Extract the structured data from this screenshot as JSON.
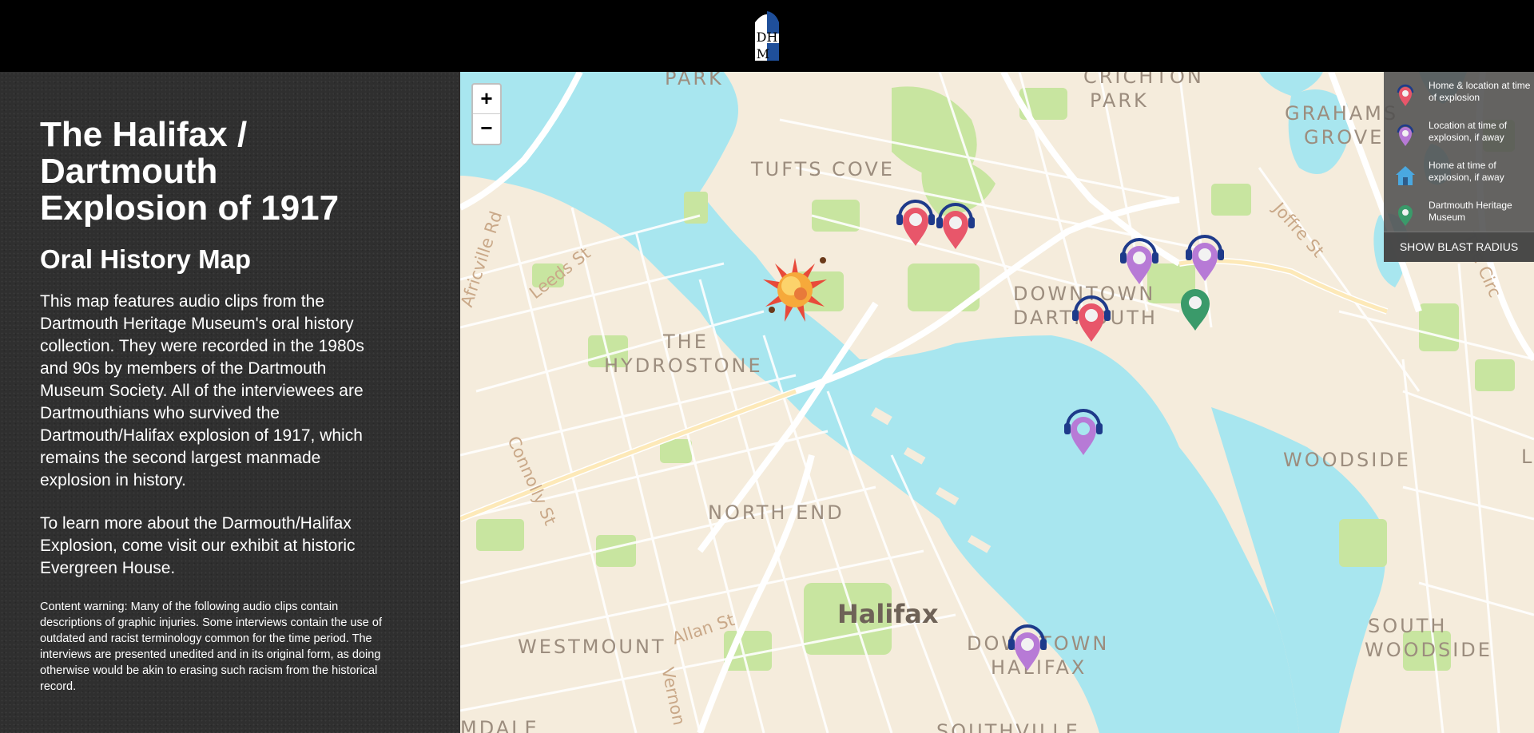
{
  "header": {
    "logo_letters": "DHM"
  },
  "sidebar": {
    "title": "The Halifax / Dartmouth Explosion of 1917",
    "subtitle": "Oral History Map",
    "paragraph1": "This map features audio clips from the Dartmouth Heritage Museum's oral history collection. They were recorded in the 1980s and 90s by members of the Dartmouth Museum Society. All of the interviewees are Dartmouthians who survived the Dartmouth/Halifax explosion of 1917, which remains the second largest manmade explosion in history.",
    "paragraph2": "To learn more about the Darmouth/Halifax Explosion, come visit our exhibit at historic Evergreen House.",
    "warning": "Content warning: Many of the following audio clips contain descriptions of graphic injuries. Some interviews contain the use of outdated and racist terminology common for the time period. The interviews are presented unedited and in its original form, as doing otherwise would be akin to erasing such racism from the historical record."
  },
  "map": {
    "zoom_in": "+",
    "zoom_out": "−",
    "labels": {
      "park": "PARK",
      "crichton_park": "CRICHTON",
      "crichton_park2": "PARK",
      "grahams_grove": "GRAHAMS",
      "grahams_grove2": "GROVE",
      "tufts_cove": "TUFTS COVE",
      "downtown_dartmouth": "DOWNTOWN",
      "downtown_dartmouth2": "DARTMOUTH",
      "the_hydrostone": "THE",
      "the_hydrostone2": "HYDROSTONE",
      "north_end": "NORTH END",
      "woodside": "WOODSIDE",
      "halifax": "Halifax",
      "westmount": "WESTMOUNT",
      "downtown_halifax": "DOWNTOWN",
      "downtown_halifax2": "HALIFAX",
      "south_woodside": "SOUTH",
      "south_woodside2": "WOODSIDE",
      "africville_rd": "Africville Rd",
      "leeds_st": "Leeds St",
      "connolly_st": "Connolly St",
      "allan_st": "Allan St",
      "vernon": "Vernon",
      "joffre_st": "Joffre St",
      "the_circ": "The Circ",
      "mdale": "MDALE",
      "southville": "SOUTHVILLE",
      "edge_l": "L"
    },
    "legend": {
      "items": [
        {
          "label": "Home & location at time of explosion",
          "color": "#e8566a",
          "icon": "map-pin-icon"
        },
        {
          "label": "Location at time of explosion, if away",
          "color": "#b77ad6",
          "icon": "map-pin-icon"
        },
        {
          "label": "Home at time of explosion, if away",
          "color": "#4aa8e0",
          "icon": "house-icon"
        },
        {
          "label": "Dartmouth Heritage Museum",
          "color": "#3a9a6a",
          "icon": "map-pin-icon"
        }
      ],
      "button": "SHOW BLAST RADIUS"
    },
    "colors": {
      "water": "#a8e6ef",
      "land": "#f5ecdc",
      "park": "#c8e5a0",
      "road": "#ffffff",
      "highway": "#fde9b8"
    }
  }
}
